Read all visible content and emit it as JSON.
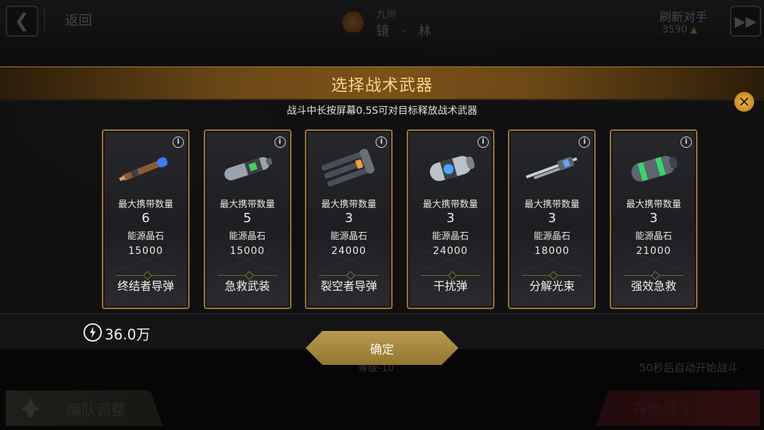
{
  "background": {
    "back_label": "返回",
    "opponent_region": "九州",
    "opponent_name": "镜 · 林",
    "refresh_label": "刷新对手",
    "refresh_cost": "3590",
    "level_text": "等级-10",
    "auto_start_text": "50秒后自动开始战斗",
    "team_adjust_label": "编队调整",
    "start_battle_label": "开始战斗"
  },
  "dialog": {
    "title": "选择战术武器",
    "hint": "战斗中长按屏幕0.5S可对目标释放战术武器",
    "confirm_label": "确定",
    "currency_value": "36.0万"
  },
  "labels": {
    "max_carry": "最大携带数量",
    "energy_crystal": "能源晶石"
  },
  "weapons": [
    {
      "name": "终结者导弹",
      "max_carry": "6",
      "cost": "15000",
      "icon": "missile-icon",
      "accent": "#3a7bff"
    },
    {
      "name": "急救武装",
      "max_carry": "5",
      "cost": "15000",
      "icon": "repair-canister-icon",
      "accent": "#3fd15a"
    },
    {
      "name": "裂空者导弹",
      "max_carry": "3",
      "cost": "24000",
      "icon": "missile-pod-icon",
      "accent": "#ff9a3a"
    },
    {
      "name": "干扰弹",
      "max_carry": "3",
      "cost": "24000",
      "icon": "jammer-shell-icon",
      "accent": "#4aa8ff"
    },
    {
      "name": "分解光束",
      "max_carry": "3",
      "cost": "18000",
      "icon": "beam-rifle-icon",
      "accent": "#6aa0ff"
    },
    {
      "name": "强效急救",
      "max_carry": "3",
      "cost": "21000",
      "icon": "heal-canister-icon",
      "accent": "#35d86a"
    }
  ]
}
